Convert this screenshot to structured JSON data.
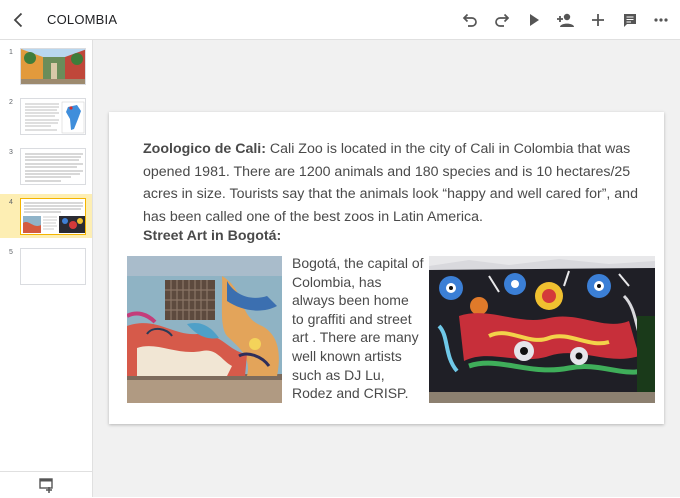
{
  "toolbar": {
    "title": "COLOMBIA",
    "icons": [
      "back-icon",
      "undo-icon",
      "redo-icon",
      "present-icon",
      "share-icon",
      "insert-icon",
      "comment-icon",
      "more-icon"
    ]
  },
  "sidebar": {
    "slides": [
      {
        "number": "1",
        "thumb": "street-photo"
      },
      {
        "number": "2",
        "thumb": "text-with-map"
      },
      {
        "number": "3",
        "thumb": "text-only"
      },
      {
        "number": "4",
        "thumb": "text-with-photos",
        "selected": true
      },
      {
        "number": "5",
        "thumb": "blank"
      }
    ]
  },
  "slide": {
    "para_title": "Zoologico de Cali:",
    "para_body": " Cali Zoo is located in the city of Cali in Colombia that was opened 1981. There are 1200 animals and 180 species and is 10 hectares/25 acres in size. Tourists say that the animals look “happy and well cared for”, and has been called one of the best zoos in Latin America.",
    "heading2": "Street Art in Bogotá:",
    "mid_text": "Bogotá, the capital of Colombia, has always been home to graffiti and street art . There are many well known artists such as DJ Lu, Rodez and CRISP."
  },
  "colors": {
    "selected_thumb_bg": "#fdeeb3",
    "selected_thumb_border": "#f4b400",
    "canvas_bg": "#f1f1f1",
    "text": "#4a4a4a"
  }
}
